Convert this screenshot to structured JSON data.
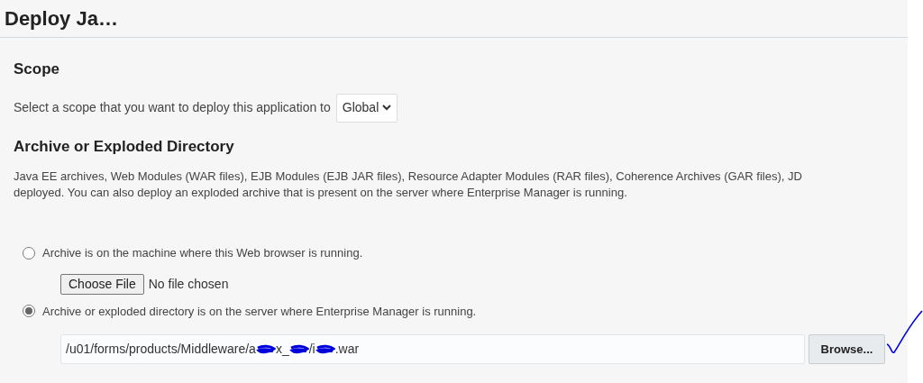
{
  "page": {
    "title": "Deploy Ja…"
  },
  "scope": {
    "heading": "Scope",
    "prompt": "Select a scope that you want to deploy this application to",
    "select_value": "Global"
  },
  "archive": {
    "heading": "Archive or Exploded Directory",
    "description_lines": [
      "Java EE archives, Web Modules (WAR files), EJB Modules (EJB JAR files), Resource Adapter Modules (RAR files), Coherence Archives (GAR files), JD",
      "deployed. You can also deploy an exploded archive that is present on the server where Enterprise Manager is running."
    ],
    "options": [
      {
        "kind": "upload",
        "label": "Archive is on the machine where this Web browser is running.",
        "selected": false,
        "button": "Choose File",
        "status": "No file chosen"
      },
      {
        "kind": "server-path",
        "label": "Archive or exploded directory is on the server where Enterprise Manager is running.",
        "selected": true,
        "path_segments": [
          "/u01/forms/products/Middleware/a",
          "x_",
          "/i",
          ".war"
        ],
        "button": "Browse..."
      }
    ]
  }
}
